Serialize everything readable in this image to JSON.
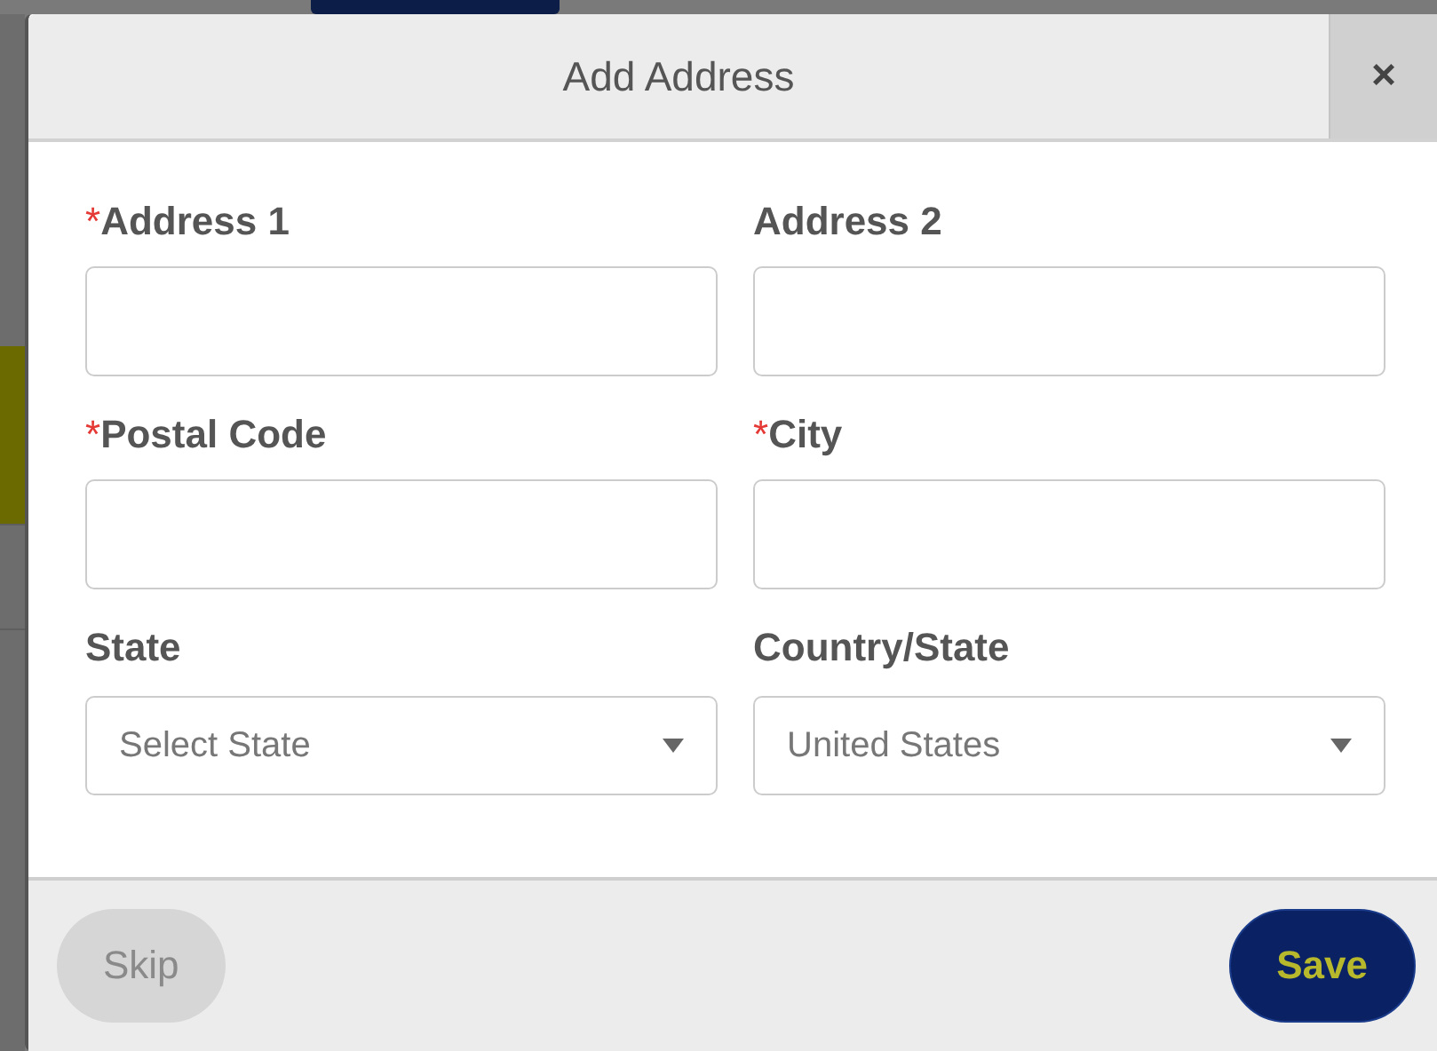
{
  "dialog": {
    "title": "Add Address",
    "close": "×",
    "required_marker": "*",
    "fields": [
      {
        "label": "Address 1",
        "required": true,
        "kind": "text"
      },
      {
        "label": "Address 2",
        "required": false,
        "kind": "text"
      },
      {
        "label": "Postal Code",
        "required": true,
        "kind": "text"
      },
      {
        "label": "City",
        "required": true,
        "kind": "text"
      },
      {
        "label": "State",
        "required": false,
        "kind": "select",
        "placeholder": "Select State"
      },
      {
        "label": "Country/State",
        "required": false,
        "kind": "select",
        "value": "United States"
      }
    ],
    "buttons": [
      {
        "label": "Skip",
        "kind": "secondary",
        "disabled": true
      },
      {
        "label": "Save",
        "kind": "primary",
        "disabled": false
      }
    ]
  }
}
